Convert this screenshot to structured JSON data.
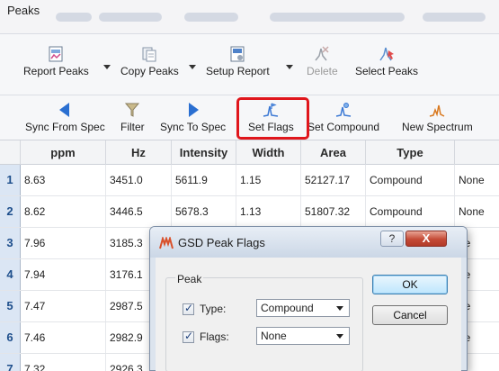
{
  "window": {
    "title": "Peaks"
  },
  "toolbar_top": [
    {
      "label": "Report Peaks",
      "icon": "report-peaks-icon",
      "dropdown": true
    },
    {
      "label": "Copy Peaks",
      "icon": "copy-peaks-icon",
      "dropdown": true
    },
    {
      "label": "Setup Report",
      "icon": "setup-report-icon",
      "dropdown": true
    },
    {
      "label": "Delete",
      "icon": "delete-peak-icon",
      "disabled": true
    },
    {
      "label": "Select Peaks",
      "icon": "select-peaks-icon"
    }
  ],
  "toolbar_bottom": [
    {
      "label": "Sync From Spec",
      "icon": "arrow-left-icon"
    },
    {
      "label": "Filter",
      "icon": "filter-icon"
    },
    {
      "label": "Sync To Spec",
      "icon": "arrow-right-icon"
    },
    {
      "label": "Set Flags",
      "icon": "peak-flag-icon",
      "highlighted": true
    },
    {
      "label": "Set Compound",
      "icon": "peak-compound-icon"
    },
    {
      "label": "New Spectrum",
      "icon": "new-spectrum-icon"
    }
  ],
  "table": {
    "columns": [
      "ppm",
      "Hz",
      "Intensity",
      "Width",
      "Area",
      "Type",
      ""
    ],
    "rows": [
      {
        "n": "1",
        "ppm": "8.63",
        "hz": "3451.0",
        "intensity": "5611.9",
        "width": "1.15",
        "area": "52127.17",
        "type": "Compound",
        "flags": "None"
      },
      {
        "n": "2",
        "ppm": "8.62",
        "hz": "3446.5",
        "intensity": "5678.3",
        "width": "1.13",
        "area": "51807.32",
        "type": "Compound",
        "flags": "None"
      },
      {
        "n": "3",
        "ppm": "7.96",
        "hz": "3185.3",
        "intensity": "",
        "width": "",
        "area": "",
        "type": "",
        "flags": "ne"
      },
      {
        "n": "4",
        "ppm": "7.94",
        "hz": "3176.1",
        "intensity": "",
        "width": "",
        "area": "",
        "type": "",
        "flags": "ne"
      },
      {
        "n": "5",
        "ppm": "7.47",
        "hz": "2987.5",
        "intensity": "",
        "width": "",
        "area": "",
        "type": "",
        "flags": "ne"
      },
      {
        "n": "6",
        "ppm": "7.46",
        "hz": "2982.9",
        "intensity": "",
        "width": "",
        "area": "",
        "type": "",
        "flags": "ne"
      },
      {
        "n": "7",
        "ppm": "7.32",
        "hz": "2926.3",
        "intensity": "",
        "width": "",
        "area": "",
        "type": "",
        "flags": ""
      }
    ]
  },
  "dialog": {
    "title": "GSD Peak Flags",
    "help_label": "?",
    "close_label": "X",
    "group_label": "Peak",
    "type_label": "Type:",
    "type_value": "Compound",
    "type_checked": true,
    "flags_label": "Flags:",
    "flags_value": "None",
    "flags_checked": true,
    "ok_label": "OK",
    "cancel_label": "Cancel"
  },
  "colors": {
    "highlight_box": "#e0161c",
    "row_number_bg": "#dbe6f4",
    "row_number_text": "#1e4f8c",
    "icon_blue": "#2a6fd1",
    "close_button": "#c44a36"
  }
}
